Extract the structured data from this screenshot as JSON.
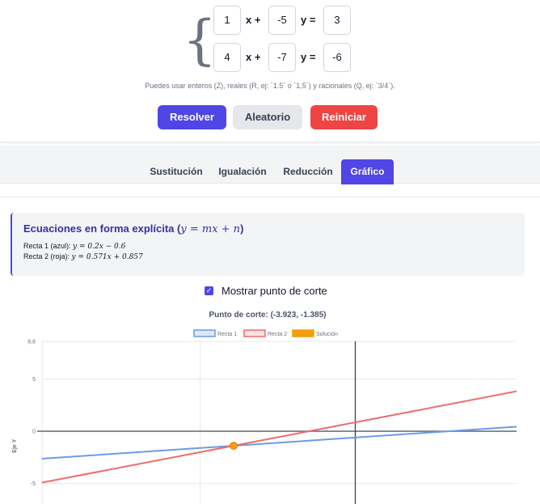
{
  "system": {
    "row1": {
      "a": "1",
      "op1": "x +",
      "b": "-5",
      "op2": "y =",
      "c": "3"
    },
    "row2": {
      "a": "4",
      "op1": "x +",
      "b": "-7",
      "op2": "y =",
      "c": "-6"
    }
  },
  "hint": "Puedes usar enteros (Z), reales (R, ej: `1.5` o `1,5`) y racionales (Q, ej: `3/4`).",
  "buttons": {
    "solve": "Resolver",
    "random": "Aleatorio",
    "reset": "Reiniciar"
  },
  "tabs": [
    {
      "label": "Sustitución",
      "active": false
    },
    {
      "label": "Igualación",
      "active": false
    },
    {
      "label": "Reducción",
      "active": false
    },
    {
      "label": "Gráfico",
      "active": true
    }
  ],
  "explicit": {
    "title": "Ecuaciones en forma explícita (",
    "title_math": "y = mx + n",
    "title_close": ")",
    "line1_label": "Recta 1 (azul):",
    "line1_math": "y = 0.2x − 0.6",
    "line2_label": "Recta 2 (roja):",
    "line2_math": "y = 0.571x + 0.857"
  },
  "checkbox": {
    "label": "Mostrar punto de corte",
    "checked": true,
    "check_glyph": "✓"
  },
  "colors": {
    "accent": "#4f46e5",
    "line1": "#6b9be8",
    "line2": "#ef6b6b",
    "solution": "#f59e0b",
    "danger": "#ef4444"
  },
  "chart_data": {
    "type": "line",
    "title": "Punto de corte: (-3.923, -1.385)",
    "ylabel": "Eje Y",
    "xlim": [
      -10.1,
      5.2
    ],
    "ylim": [
      -7.5,
      8.6
    ],
    "y_ticks": [
      "8,6",
      "5",
      "0",
      "-5"
    ],
    "y_tick_values": [
      8.6,
      5,
      0,
      -5
    ],
    "legend": [
      "Recta 1",
      "Recta 2",
      "Solución"
    ],
    "legend_placement": "top",
    "grid": true,
    "series": [
      {
        "name": "Recta 1",
        "slope": 0.2,
        "intercept": -0.6,
        "color": "#6b9be8"
      },
      {
        "name": "Recta 2",
        "slope": 0.571,
        "intercept": 0.857,
        "color": "#ef6b6b"
      }
    ],
    "solution": {
      "name": "Solución",
      "x": -3.923,
      "y": -1.385,
      "color": "#f59e0b"
    }
  }
}
